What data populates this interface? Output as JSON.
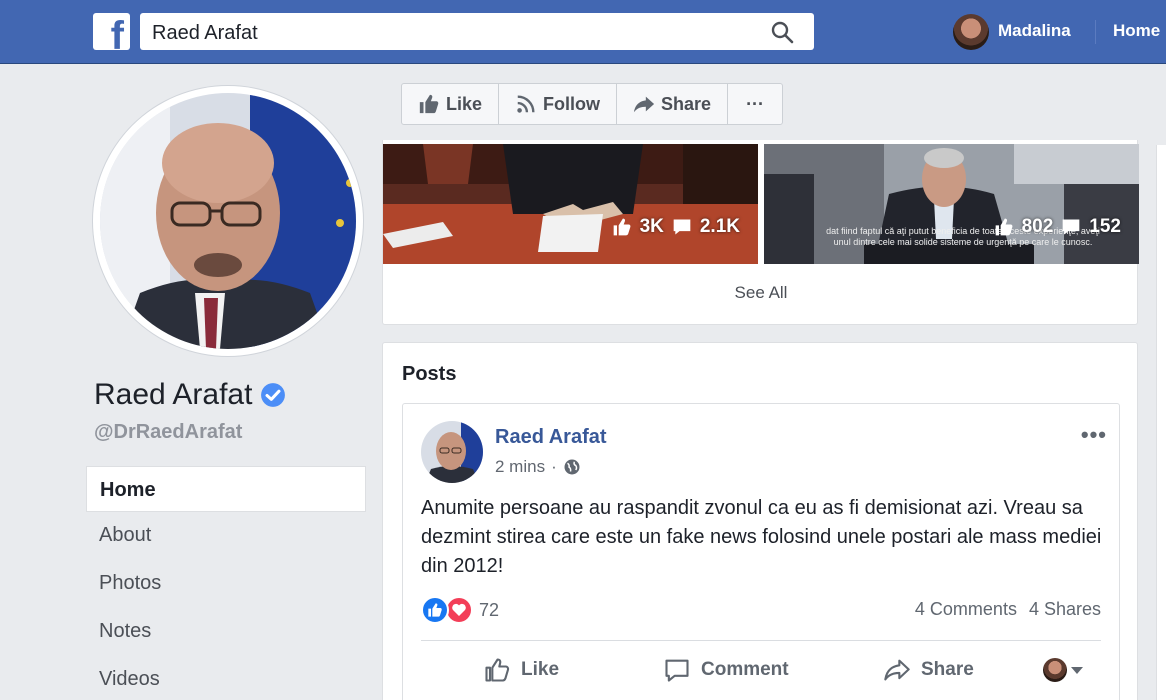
{
  "topbar": {
    "logo": "f",
    "search_value": "Raed Arafat",
    "user_name": "Madalina",
    "home_label": "Home"
  },
  "profile": {
    "name": "Raed Arafat",
    "handle": "@DrRaedArafat"
  },
  "side_nav": [
    {
      "label": "Home",
      "active": true
    },
    {
      "label": "About"
    },
    {
      "label": "Photos"
    },
    {
      "label": "Notes"
    },
    {
      "label": "Videos"
    }
  ],
  "page_actions": {
    "like": "Like",
    "follow": "Follow",
    "share": "Share",
    "more": "···"
  },
  "videos": [
    {
      "likes": "3K",
      "comments": "2.1K"
    },
    {
      "likes": "802",
      "comments": "152",
      "caption": "dat fiind faptul că aţi putut beneficia de toate aceste experienţe, aveţi unul dintre cele mai solide sisteme de urgenţă pe care le cunosc."
    }
  ],
  "see_all": "See All",
  "posts": {
    "title": "Posts",
    "author": "Raed Arafat",
    "time": "2 mins",
    "time_sep": "·",
    "menu": "•••",
    "text": "Anumite persoane au raspandit zvonul ca eu as fi demisionat azi. Vreau sa dezmint stirea care este un fake news folosind unele postari ale mass mediei din 2012!",
    "reaction_count": "72",
    "comments": "4 Comments",
    "shares": "4 Shares",
    "actions": {
      "like": "Like",
      "comment": "Comment",
      "share": "Share"
    }
  },
  "colors": {
    "brand_blue": "#4267b2",
    "link_blue": "#385898",
    "like_blue": "#1877f2",
    "love_red": "#f33e58"
  }
}
